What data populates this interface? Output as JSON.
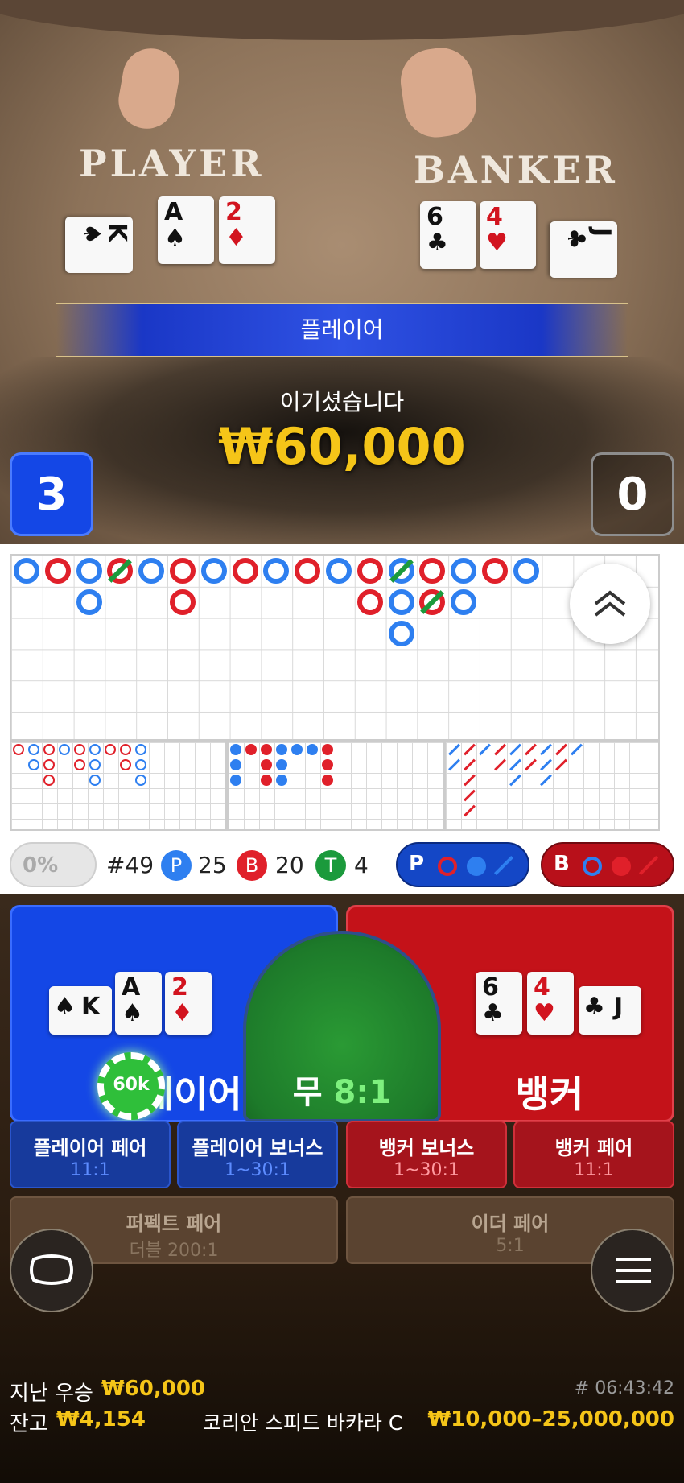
{
  "table": {
    "player_label": "PLAYER",
    "banker_label": "BANKER"
  },
  "player_cards": [
    {
      "rank": "K",
      "suit": "♠",
      "color": "blk"
    },
    {
      "rank": "A",
      "suit": "♠",
      "color": "blk"
    },
    {
      "rank": "2",
      "suit": "♦",
      "color": "red"
    }
  ],
  "banker_cards": [
    {
      "rank": "6",
      "suit": "♣",
      "color": "blk"
    },
    {
      "rank": "4",
      "suit": "♥",
      "color": "red"
    },
    {
      "rank": "J",
      "suit": "♣",
      "color": "blk"
    }
  ],
  "result": {
    "winner": "플레이어",
    "message": "이기셨습니다",
    "amount": "₩60,000"
  },
  "scores": {
    "player": "3",
    "banker": "0"
  },
  "stats": {
    "percent": "0%",
    "round": "#49",
    "p_badge": "P",
    "p_count": "25",
    "b_badge": "B",
    "b_count": "20",
    "t_badge": "T",
    "t_count": "4",
    "p_predict": "P",
    "b_predict": "B"
  },
  "bets": {
    "player": "플레이어",
    "tie": "무",
    "tie_odds": "8:1",
    "banker": "뱅커",
    "chip": "60k",
    "player_pair": {
      "label": "플레이어 페어",
      "odds": "11:1"
    },
    "player_bonus": {
      "label": "플레이어 보너스",
      "odds": "1~30:1"
    },
    "banker_bonus": {
      "label": "뱅커 보너스",
      "odds": "1~30:1"
    },
    "banker_pair": {
      "label": "뱅커 페어",
      "odds": "11:1"
    },
    "perfect_pair": {
      "label": "퍼펙트 페어",
      "odds": "더블 200:1"
    },
    "either_pair": {
      "label": "이더 페어",
      "odds": "5:1"
    }
  },
  "footer": {
    "last_win_label": "지난 우승",
    "last_win": "₩60,000",
    "balance_label": "잔고",
    "balance": "₩4,154",
    "game_id": "# 06:43:42",
    "table_name": "코리안 스피드 바카라 C",
    "limits": "₩10,000–25,000,000"
  },
  "colors": {
    "player_blue": "#1447e6",
    "banker_red": "#c41219",
    "tie_green": "#1d7a2a",
    "gold": "#f5c518"
  }
}
